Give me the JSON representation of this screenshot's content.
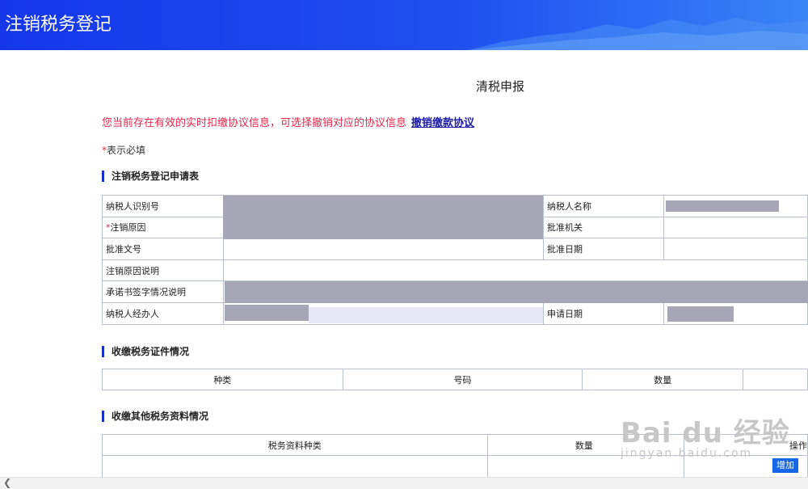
{
  "header": {
    "title": "注销税务登记"
  },
  "page": {
    "title": "清税申报",
    "warning": "您当前存在有效的实时扣缴协议信息，可选择撤销对应的协议信息",
    "warning_link": "撤销缴款协议",
    "required_star": "*",
    "required_note": "表示必填"
  },
  "sections": {
    "application": "注销税务登记申请表",
    "certificates": "收缴税务证件情况",
    "other_docs": "收缴其他税务资料情况"
  },
  "form": {
    "taxpayer_id_label": "纳税人识别号",
    "taxpayer_name_label": "纳税人名称",
    "cancel_reason_label": "注销原因",
    "approve_org_label": "批准机关",
    "approve_doc_label": "批准文号",
    "approve_date_label": "批准日期",
    "reason_desc_label": "注销原因说明",
    "commitment_label": "承诺书签字情况说明",
    "agent_label": "纳税人经办人",
    "apply_date_label": "申请日期"
  },
  "cert_table": {
    "headers": [
      "种类",
      "号码",
      "数量"
    ]
  },
  "docs_table": {
    "headers": [
      "税务资料种类",
      "数量",
      "操作"
    ],
    "add_label": "增加"
  },
  "watermark": {
    "main": "Bai du 经验",
    "sub": "jingyan.baidu.com"
  },
  "colors": {
    "header_blue": "#1537e8",
    "warning_red": "#e8264a",
    "link_blue": "#1a1aa8",
    "button_blue": "#1666e8"
  }
}
